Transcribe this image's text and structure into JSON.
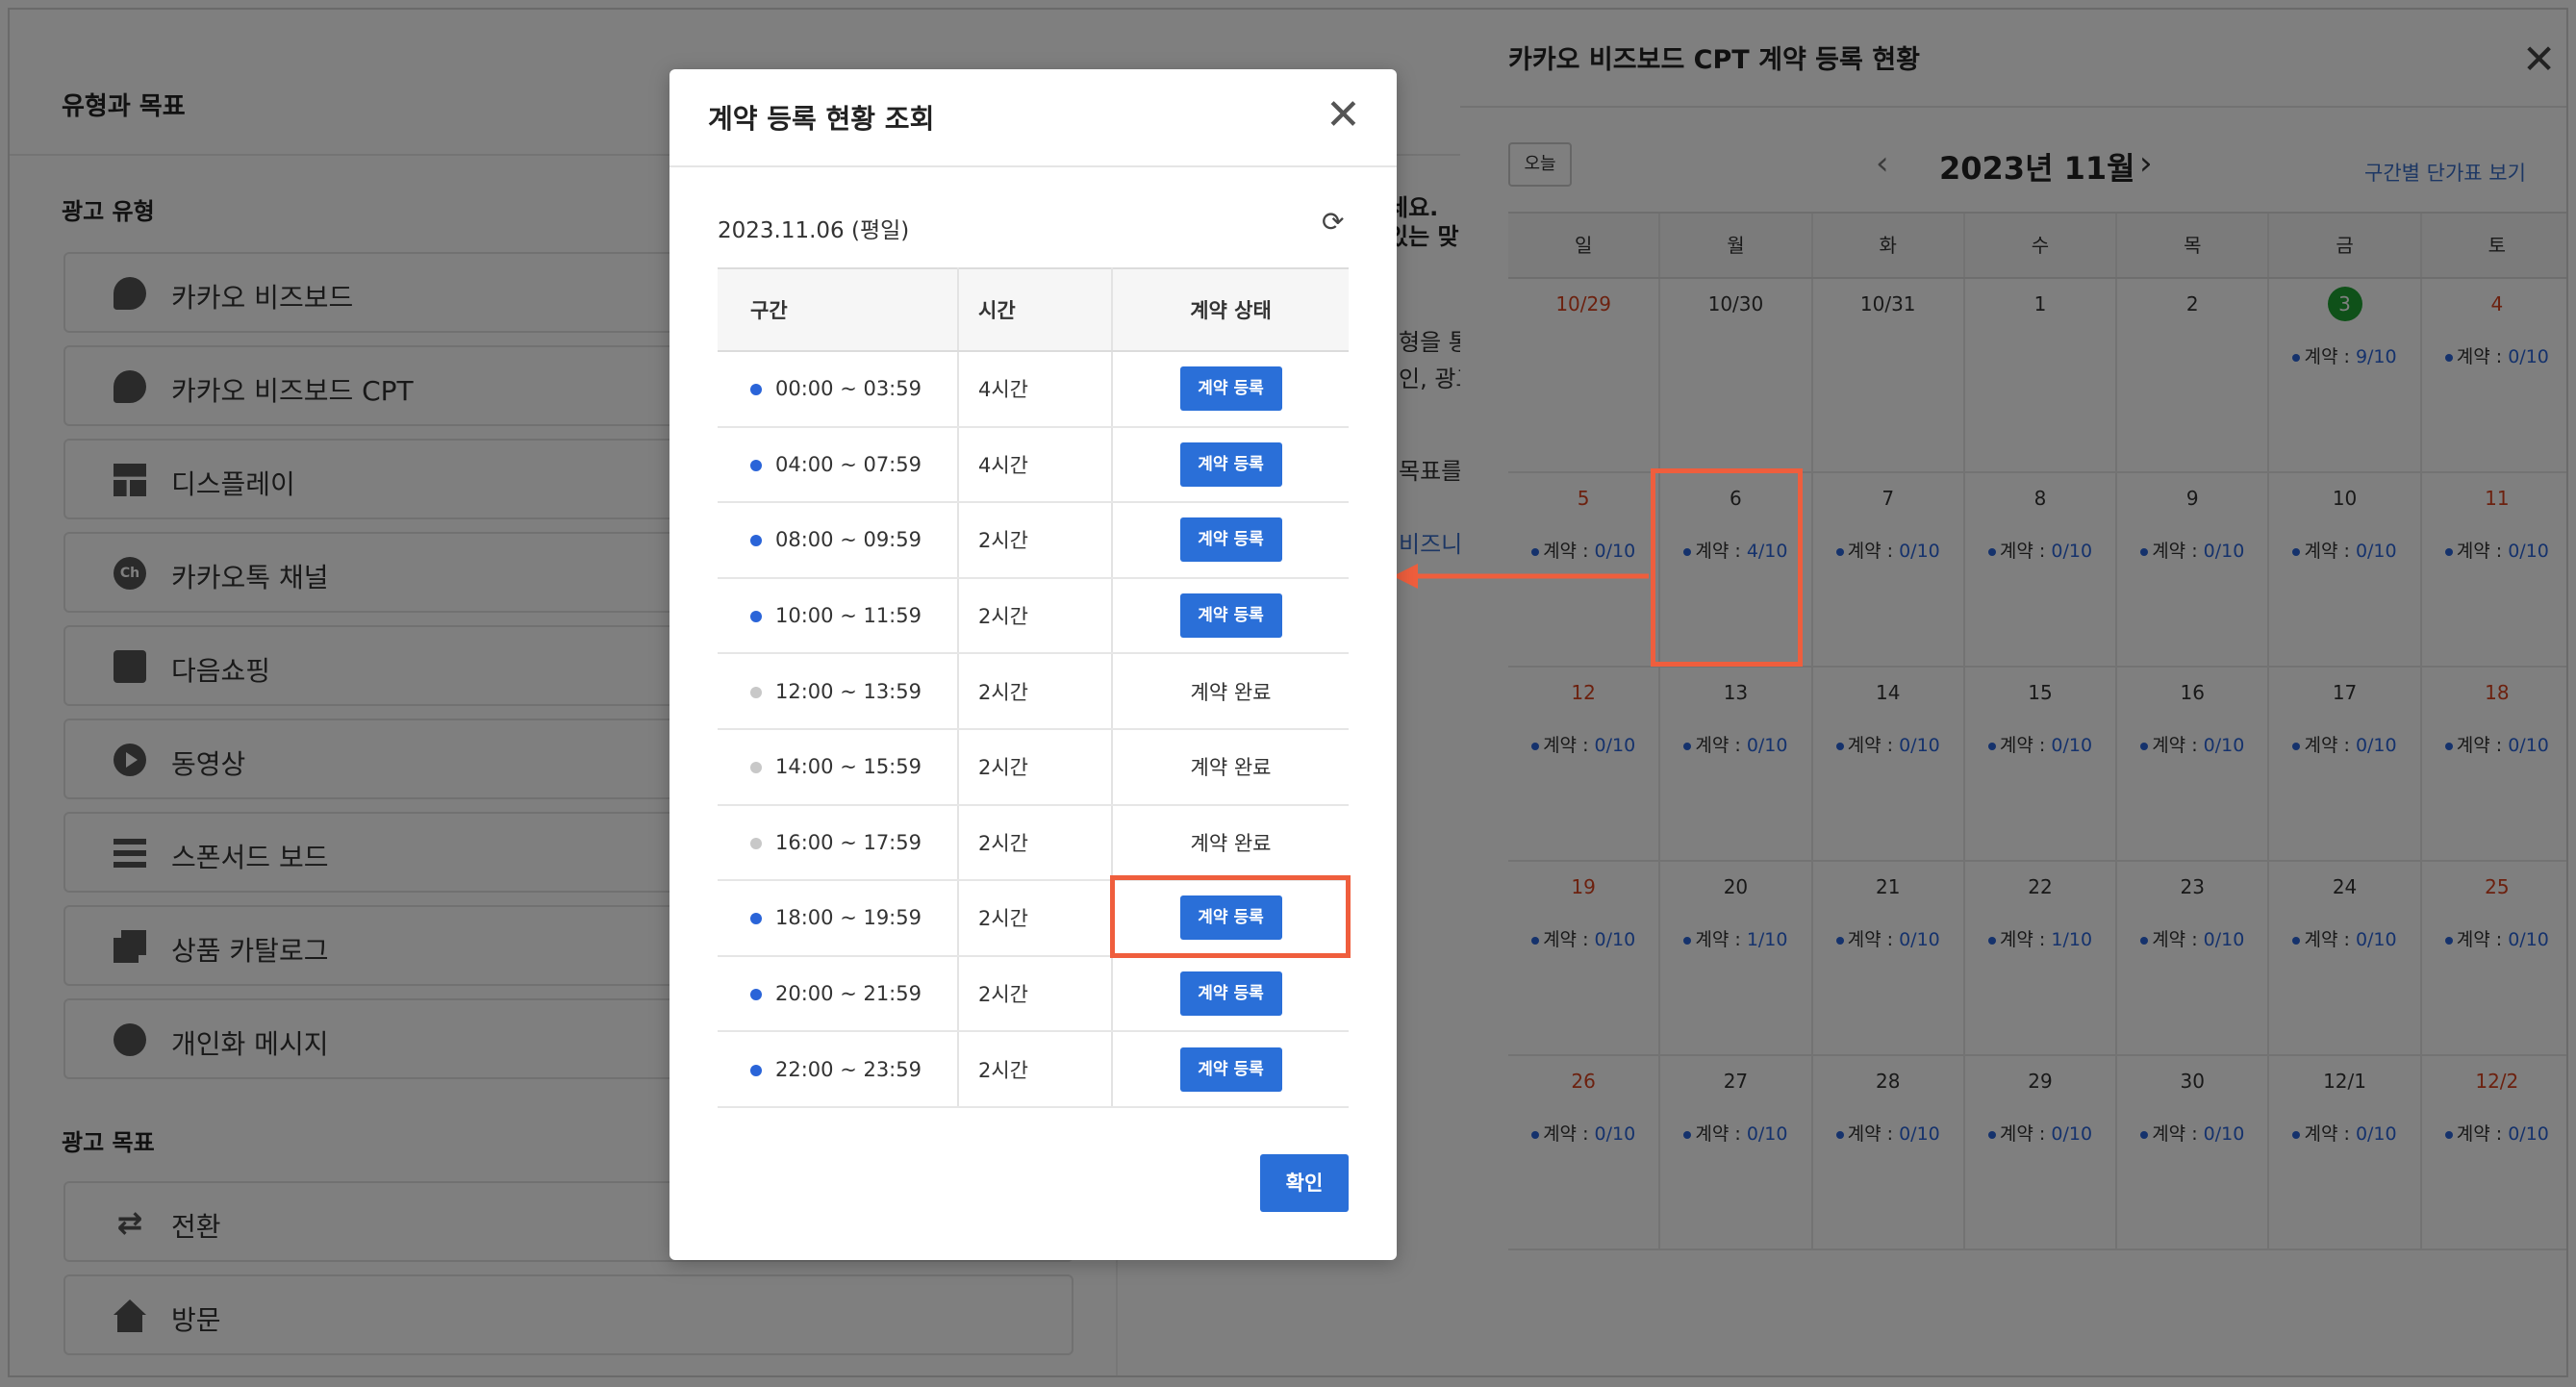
{
  "left_page": {
    "title": "유형과 목표",
    "ad_type_heading": "광고 유형",
    "ad_types": [
      {
        "label": "카카오 비즈보드",
        "icon": "chat-bubble-icon"
      },
      {
        "label": "카카오 비즈보드 CPT",
        "icon": "chat-bubble-icon"
      },
      {
        "label": "디스플레이",
        "icon": "layout-grid-icon"
      },
      {
        "label": "카카오톡 채널",
        "icon": "channel-icon"
      },
      {
        "label": "다음쇼핑",
        "icon": "shopping-bag-icon"
      },
      {
        "label": "동영상",
        "icon": "play-icon"
      },
      {
        "label": "스폰서드 보드",
        "icon": "list-lines-icon"
      },
      {
        "label": "상품 카탈로그",
        "icon": "cards-icon"
      },
      {
        "label": "개인화 메시지",
        "icon": "person-icon"
      }
    ],
    "goal_heading": "광고 목표",
    "goals": [
      {
        "label": "전환",
        "icon": "swap-arrows-icon"
      },
      {
        "label": "방문",
        "icon": "home-icon"
      }
    ],
    "peek_texts": [
      "세요.",
      "있는 맞",
      "형을 통",
      "인, 광고",
      "목표를",
      "비즈니"
    ]
  },
  "calendar_panel": {
    "title": "카카오 비즈보드 CPT 계약 등록 현황",
    "today_label": "오늘",
    "month_label": "2023년 11월",
    "range_link": "구간별 단가표 보기",
    "count_prefix": "계약 : ",
    "weekdays": [
      "일",
      "월",
      "화",
      "수",
      "목",
      "금",
      "토"
    ],
    "weeks": [
      [
        {
          "day": "10/29",
          "red": true,
          "count": ""
        },
        {
          "day": "10/30",
          "count": ""
        },
        {
          "day": "10/31",
          "count": ""
        },
        {
          "day": "1",
          "count": ""
        },
        {
          "day": "2",
          "count": ""
        },
        {
          "day": "3",
          "today": true,
          "count": "9/10"
        },
        {
          "day": "4",
          "red": true,
          "count": "0/10"
        }
      ],
      [
        {
          "day": "5",
          "red": true,
          "count": "0/10"
        },
        {
          "day": "6",
          "count": "4/10"
        },
        {
          "day": "7",
          "count": "0/10"
        },
        {
          "day": "8",
          "count": "0/10"
        },
        {
          "day": "9",
          "count": "0/10"
        },
        {
          "day": "10",
          "count": "0/10"
        },
        {
          "day": "11",
          "red": true,
          "count": "0/10"
        }
      ],
      [
        {
          "day": "12",
          "red": true,
          "count": "0/10"
        },
        {
          "day": "13",
          "count": "0/10"
        },
        {
          "day": "14",
          "count": "0/10"
        },
        {
          "day": "15",
          "count": "0/10"
        },
        {
          "day": "16",
          "count": "0/10"
        },
        {
          "day": "17",
          "count": "0/10"
        },
        {
          "day": "18",
          "red": true,
          "count": "0/10"
        }
      ],
      [
        {
          "day": "19",
          "red": true,
          "count": "0/10"
        },
        {
          "day": "20",
          "count": "1/10"
        },
        {
          "day": "21",
          "count": "0/10"
        },
        {
          "day": "22",
          "count": "1/10"
        },
        {
          "day": "23",
          "count": "0/10"
        },
        {
          "day": "24",
          "count": "0/10"
        },
        {
          "day": "25",
          "red": true,
          "count": "0/10"
        }
      ],
      [
        {
          "day": "26",
          "red": true,
          "count": "0/10"
        },
        {
          "day": "27",
          "count": "0/10"
        },
        {
          "day": "28",
          "count": "0/10"
        },
        {
          "day": "29",
          "count": "0/10"
        },
        {
          "day": "30",
          "count": "0/10"
        },
        {
          "day": "12/1",
          "count": "0/10"
        },
        {
          "day": "12/2",
          "red": true,
          "count": "0/10"
        }
      ]
    ]
  },
  "modal": {
    "title": "계약 등록 현황 조회",
    "date": "2023.11.06 (평일)",
    "columns": [
      "구간",
      "시간",
      "계약 상태"
    ],
    "register_label": "계약 등록",
    "done_label": "계약 완료",
    "rows": [
      {
        "range": "00:00 ~ 03:59",
        "duration": "4시간",
        "status": "register"
      },
      {
        "range": "04:00 ~ 07:59",
        "duration": "4시간",
        "status": "register"
      },
      {
        "range": "08:00 ~ 09:59",
        "duration": "2시간",
        "status": "register"
      },
      {
        "range": "10:00 ~ 11:59",
        "duration": "2시간",
        "status": "register"
      },
      {
        "range": "12:00 ~ 13:59",
        "duration": "2시간",
        "status": "done"
      },
      {
        "range": "14:00 ~ 15:59",
        "duration": "2시간",
        "status": "done"
      },
      {
        "range": "16:00 ~ 17:59",
        "duration": "2시간",
        "status": "done"
      },
      {
        "range": "18:00 ~ 19:59",
        "duration": "2시간",
        "status": "register"
      },
      {
        "range": "20:00 ~ 21:59",
        "duration": "2시간",
        "status": "register"
      },
      {
        "range": "22:00 ~ 23:59",
        "duration": "2시간",
        "status": "register"
      }
    ],
    "confirm_label": "확인"
  },
  "colors": {
    "accent_blue": "#2a6fd8",
    "highlight_orange": "#ef5e3d",
    "today_green": "#1fa233",
    "weekend_red": "#d9421f"
  }
}
